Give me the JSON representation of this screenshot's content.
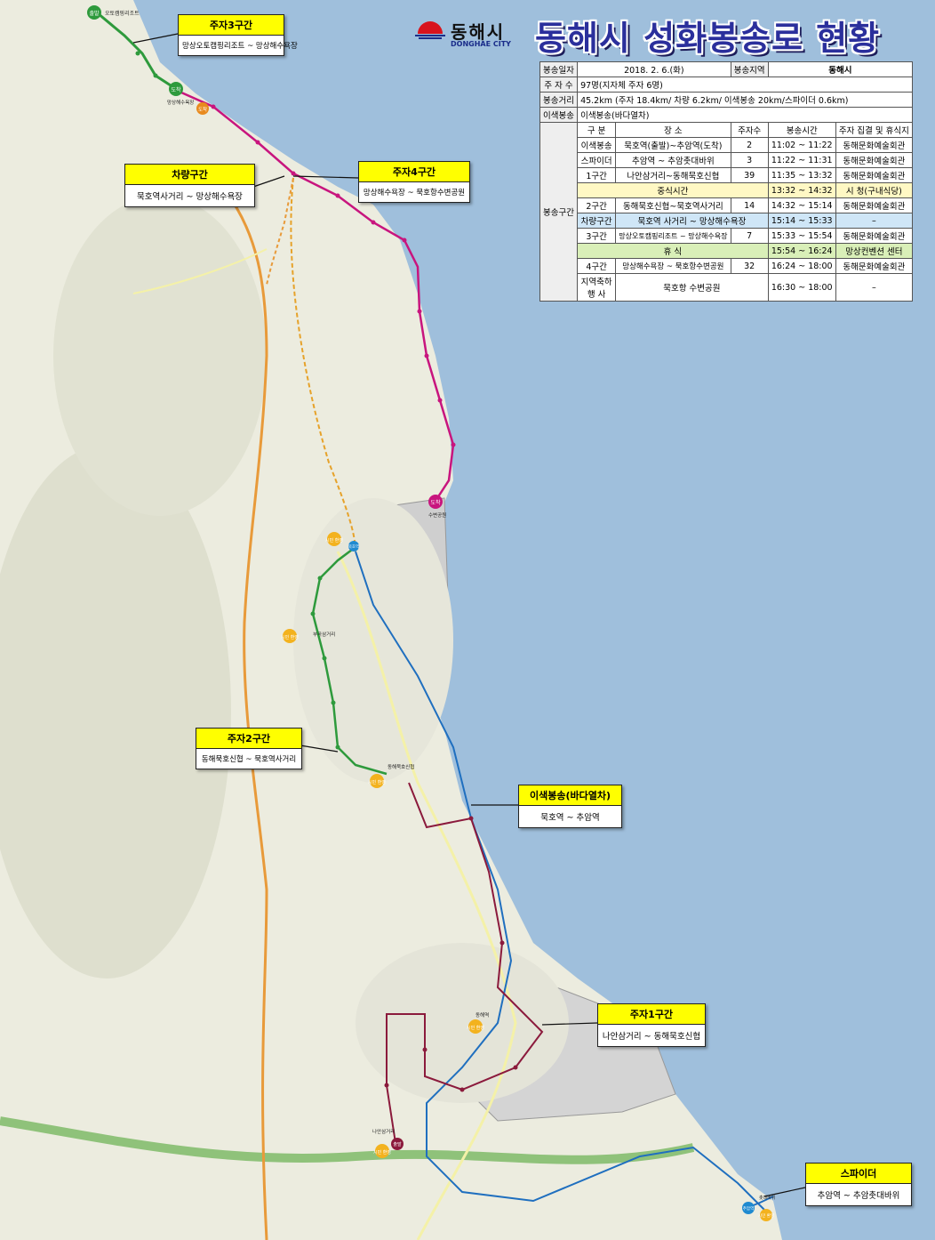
{
  "brand": {
    "name": "동해시",
    "sub": "DONGHAE CITY"
  },
  "title": "동해시 성화봉송로 현황",
  "info_table": {
    "date_label": "봉송일자",
    "date": "2018. 2. 6.(화)",
    "region_label": "봉송지역",
    "region": "동해시",
    "runners_label": "주 자 수",
    "runners": "97명(지자체 주자 6명)",
    "distance_label": "봉송거리",
    "distance": "45.2km (주자 18.4km/ 차량 6.2km/ 이색봉송 20km/스파이더 0.6km)",
    "special_label": "이색봉송",
    "special": "이색봉송(바다열차)",
    "section_label": "봉송구간",
    "headers": [
      "구 분",
      "장 소",
      "주자수",
      "봉송시간",
      "주자 집결 및 휴식지"
    ],
    "rows": [
      [
        "이색봉송",
        "묵호역(출발)~추암역(도착)",
        "2",
        "11:02 ~ 11:22",
        "동해문화예술회관"
      ],
      [
        "스파이더",
        "추암역 ~ 추암촛대바위",
        "3",
        "11:22 ~ 11:31",
        "동해문화예술회관"
      ],
      [
        "1구간",
        "나안삼거리~동해묵호신협",
        "39",
        "11:35 ~ 13:32",
        "동해문화예술회관"
      ],
      [
        "중식시간",
        "13:32 ~ 14:32",
        "시 청(구내식당)"
      ],
      [
        "2구간",
        "동해묵호신협~묵호역사거리",
        "14",
        "14:32 ~ 15:14",
        "동해문화예술회관"
      ],
      [
        "차량구간",
        "묵호역 사거리 ~ 망상해수욕장",
        "15:14 ~ 15:33",
        "–"
      ],
      [
        "3구간",
        "망상오토캠핑리조트 ~ 망상해수욕장",
        "7",
        "15:33 ~ 15:54",
        "동해문화예술회관"
      ],
      [
        "휴 식",
        "15:54 ~ 16:24",
        "망상컨벤션 센터"
      ],
      [
        "4구간",
        "망상해수욕장 ~ 묵호항수변공원",
        "32",
        "16:24 ~ 18:00",
        "동해문화예술회관"
      ],
      [
        "지역축하 행 사",
        "묵호항 수변공원",
        "16:30 ~ 18:00",
        "–"
      ]
    ]
  },
  "callouts": {
    "sec3": {
      "title": "주자3구간",
      "text": "망상오토캠핑리조트 ~ 망상해수욕장"
    },
    "car": {
      "title": "차량구간",
      "text": "묵호역사거리 ~ 망상해수욕장"
    },
    "sec4": {
      "title": "주자4구간",
      "text": "망상해수욕장 ~ 묵호항수변공원"
    },
    "sec2": {
      "title": "주자2구간",
      "text": "동해묵호신협 ~ 묵호역사거리"
    },
    "train": {
      "title": "이색봉송(바다열차)",
      "text": "묵호역 ~ 추암역"
    },
    "sec1": {
      "title": "주자1구간",
      "text": "나안삼거리 ~ 동해묵호신협"
    },
    "spider": {
      "title": "스파이더",
      "text": "추암역 ~ 추암촛대바위"
    }
  },
  "pins": {
    "start": "출발",
    "arrive": "도착",
    "ceremony": "시민 환영",
    "resort": "오토캠핑리조트",
    "beach": "망상해수욕장",
    "park": "수변공원",
    "mukho": "묵호역",
    "crossing": "부곡삼거리",
    "shinhyup": "동해묵호신협",
    "naan": "나안삼거리",
    "donghae_stn": "동해역",
    "chuam": "추암역",
    "rock": "촛대바위"
  },
  "colors": {
    "sea": "#9fbfdc",
    "land": "#ececdf",
    "green_route": "#2e9a3c",
    "magenta_route": "#c8157e",
    "maroon_route": "#8b1a3c",
    "blue_route": "#1f6fbf",
    "highway": "#e89a3a",
    "callout_header": "#ffff00",
    "title": "#2b2f9c"
  }
}
